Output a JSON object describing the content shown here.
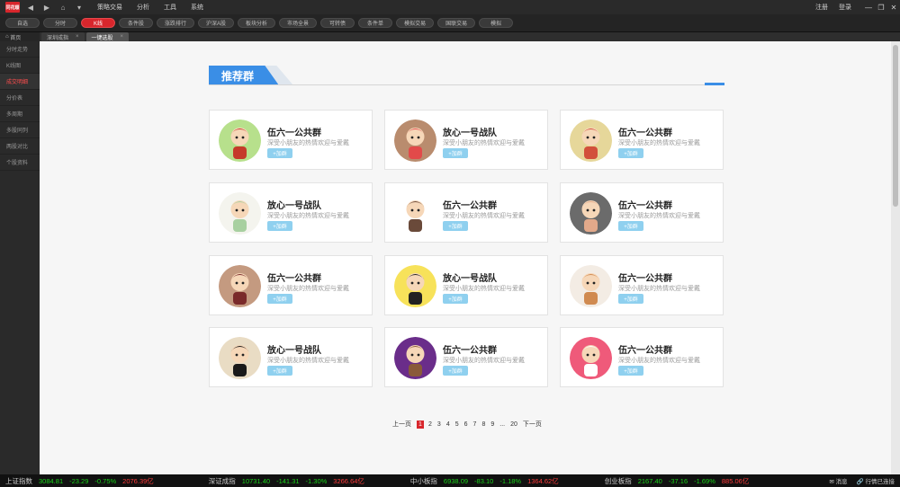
{
  "titlebar": {
    "logo": "同花顺",
    "menu": [
      "策略交易",
      "分析",
      "工具",
      "系统"
    ],
    "right_links": [
      "注册",
      "登录"
    ]
  },
  "toolbar": {
    "buttons": [
      "自选",
      "分时",
      "K线",
      "条件股",
      "涨跌排行",
      "沪深A股",
      "板块分析",
      "市场全景",
      "可转债",
      "条件单",
      "模拟交易",
      "国联交易",
      "模拟"
    ],
    "active_index": 2
  },
  "tabs": {
    "home": "首页",
    "items": [
      {
        "label": "深圳成指",
        "close": "×"
      },
      {
        "label": "一键选股",
        "close": "×"
      }
    ]
  },
  "sidebar": {
    "items": [
      "分时走势",
      "K线图",
      "成交明细",
      "分价表",
      "多周期",
      "多股同列",
      "两股对比",
      "个股资料"
    ],
    "active_index": 2
  },
  "section": {
    "title": "推荐群"
  },
  "cards": [
    {
      "title": "伍六一公共群",
      "desc": "深受小朋友的热情欢迎与爱戴",
      "join": "+加群",
      "avatar_bg": "#b7e08c",
      "avatar_fg": "#c53a2a"
    },
    {
      "title": "放心一号战队",
      "desc": "深受小朋友的热情欢迎与爱戴",
      "join": "+加群",
      "avatar_bg": "#b98c6e",
      "avatar_fg": "#e24a4a"
    },
    {
      "title": "伍六一公共群",
      "desc": "深受小朋友的热情欢迎与爱戴",
      "join": "+加群",
      "avatar_bg": "#e6d79a",
      "avatar_fg": "#d2503b"
    },
    {
      "title": "放心一号战队",
      "desc": "深受小朋友的热情欢迎与爱戴",
      "join": "+加群",
      "avatar_bg": "#f4f4ee",
      "avatar_fg": "#a8d0a0"
    },
    {
      "title": "伍六一公共群",
      "desc": "深受小朋友的热情欢迎与爱戴",
      "join": "+加群",
      "avatar_bg": "#ffffff",
      "avatar_fg": "#6a4a3a"
    },
    {
      "title": "伍六一公共群",
      "desc": "深受小朋友的热情欢迎与爱戴",
      "join": "+加群",
      "avatar_bg": "#6b6b6b",
      "avatar_fg": "#e3a98a"
    },
    {
      "title": "伍六一公共群",
      "desc": "深受小朋友的热情欢迎与爱戴",
      "join": "+加群",
      "avatar_bg": "#c49a80",
      "avatar_fg": "#7a2a2a"
    },
    {
      "title": "放心一号战队",
      "desc": "深受小朋友的热情欢迎与爱戴",
      "join": "+加群",
      "avatar_bg": "#f7e25a",
      "avatar_fg": "#222222"
    },
    {
      "title": "伍六一公共群",
      "desc": "深受小朋友的热情欢迎与爱戴",
      "join": "+加群",
      "avatar_bg": "#f3ece4",
      "avatar_fg": "#d08a50"
    },
    {
      "title": "放心一号战队",
      "desc": "深受小朋友的热情欢迎与爱戴",
      "join": "+加群",
      "avatar_bg": "#e9dcc4",
      "avatar_fg": "#1a1a1a"
    },
    {
      "title": "伍六一公共群",
      "desc": "深受小朋友的热情欢迎与爱戴",
      "join": "+加群",
      "avatar_bg": "#6a2d8a",
      "avatar_fg": "#8a5a3a"
    },
    {
      "title": "伍六一公共群",
      "desc": "深受小朋友的热情欢迎与爱戴",
      "join": "+加群",
      "avatar_bg": "#ef5a7a",
      "avatar_fg": "#ffffff"
    }
  ],
  "pager": {
    "prev": "上一页",
    "pages": [
      "1",
      "2",
      "3",
      "4",
      "5",
      "6",
      "7",
      "8",
      "9",
      "...",
      "20"
    ],
    "current": "1",
    "next": "下一页"
  },
  "statusbar": {
    "indices": [
      {
        "name": "上证指数",
        "value": "3084.81",
        "change": "-23.29",
        "pct": "-0.75%",
        "amount": "2076.39亿"
      },
      {
        "name": "深证成指",
        "value": "10731.40",
        "change": "-141.31",
        "pct": "-1.30%",
        "amount": "3266.64亿"
      },
      {
        "name": "中小板指",
        "value": "6938.09",
        "change": "-83.10",
        "pct": "-1.18%",
        "amount": "1364.62亿"
      },
      {
        "name": "创业板指",
        "value": "2167.40",
        "change": "-37.16",
        "pct": "-1.69%",
        "amount": "885.06亿"
      }
    ],
    "msg": "消息",
    "conn": "行情已连接"
  }
}
